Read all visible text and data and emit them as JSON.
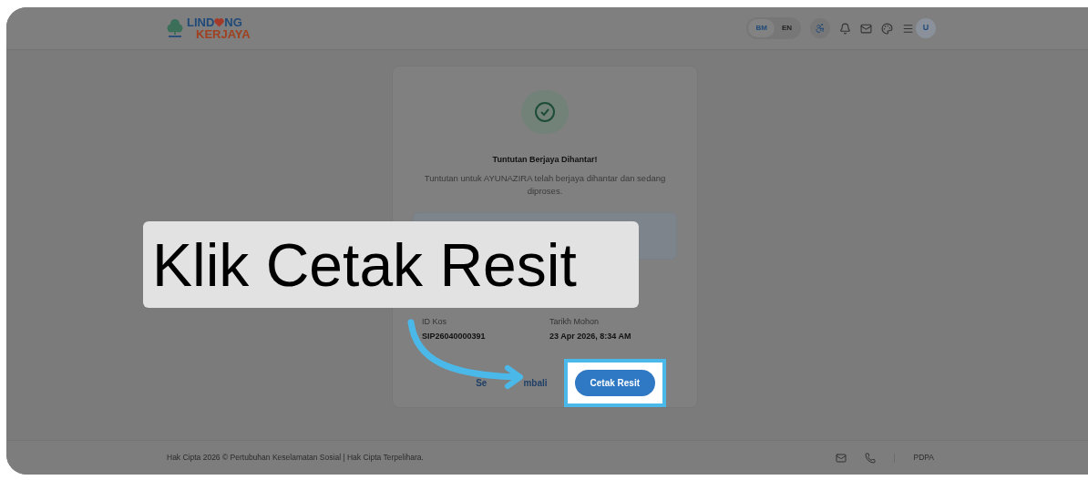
{
  "header": {
    "logo": {
      "before_heart": "LIND",
      "after_heart": "NG",
      "line_2": "KERJAYA"
    },
    "languages": [
      {
        "label": "BM",
        "selected": true
      },
      {
        "label": "EN",
        "selected": false
      }
    ],
    "avatar": "U"
  },
  "card": {
    "title": "Tuntutan Berjaya Dihantar!",
    "message": "Tuntutan untuk AYUNAZIRA telah berjaya dihantar dan sedang diproses.",
    "details": [
      {
        "label": "ID Kos",
        "value": "SIP26040000391"
      },
      {
        "label": "Tarikh Mohon",
        "value": "23 Apr 2026, 8:34 AM"
      }
    ],
    "secondary_action_parts": [
      "Se",
      "mbali"
    ],
    "primary_action": "Cetak Resit"
  },
  "annotation": {
    "caption": "Klik Cetak Resit"
  },
  "footer": {
    "copyright": "Hak Cipta 2026 © Pertubuhan Keselamatan Sosial | Hak Cipta Terpelihara.",
    "link": "PDPA"
  }
}
